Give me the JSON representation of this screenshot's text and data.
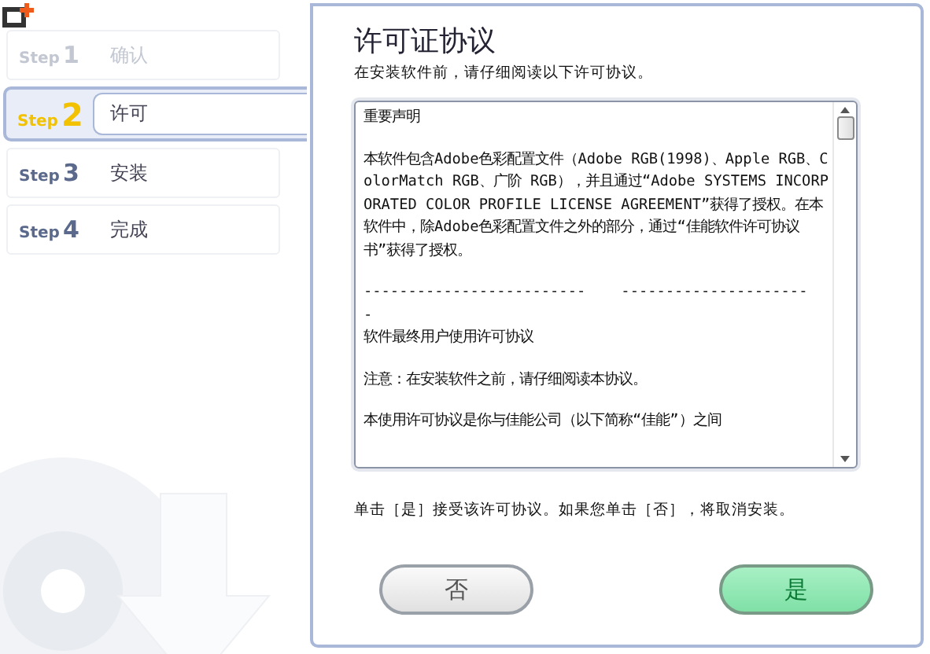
{
  "steps": [
    {
      "step": "Step",
      "number": "1",
      "label": "确认",
      "selected": false,
      "done": true
    },
    {
      "step": "Step",
      "number": "2",
      "label": "许可",
      "selected": true,
      "done": false
    },
    {
      "step": "Step",
      "number": "3",
      "label": "安装",
      "selected": false,
      "done": false
    },
    {
      "step": "Step",
      "number": "4",
      "label": "完成",
      "selected": false,
      "done": false
    }
  ],
  "page": {
    "title": "许可证协议",
    "subtitle": "在安装软件前，请仔细阅读以下许可协议。"
  },
  "license": {
    "paragraphs": [
      "重要声明",
      "本软件包含Adobe色彩配置文件（Adobe RGB(1998)、Apple RGB、ColorMatch RGB、广阶 RGB），并且通过“Adobe SYSTEMS INCORPORATED COLOR PROFILE LICENSE AGREEMENT”获得了授权。在本软件中，除Adobe色彩配置文件之外的部分，通过“佳能软件许可协议书”获得了授权。",
      "-------------------------    ---------------------\n-",
      "软件最终用户使用许可协议",
      "注意：在安装软件之前，请仔细阅读本协议。",
      "本使用许可协议是你与佳能公司（以下简称“佳能”）之间"
    ]
  },
  "instruction": "单击［是］接受该许可协议。如果您单击［否］，将取消安装。",
  "buttons": [
    {
      "label": "否",
      "kind": "secondary"
    },
    {
      "label": "是",
      "kind": "primary"
    }
  ]
}
